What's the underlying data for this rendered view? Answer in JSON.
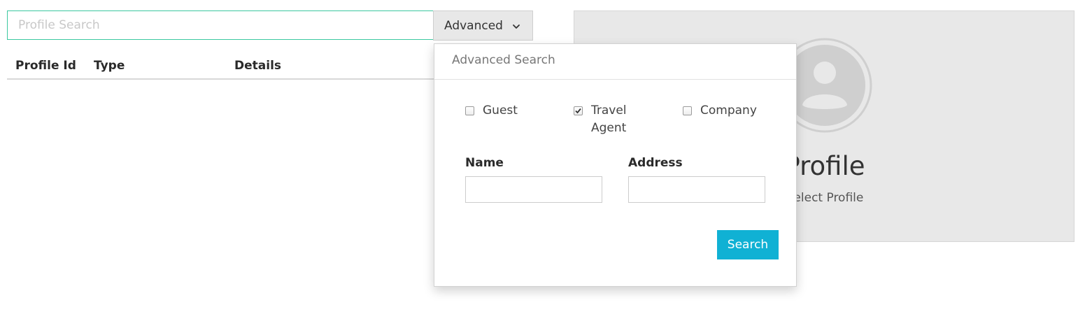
{
  "search": {
    "placeholder": "Profile Search",
    "value": ""
  },
  "advanced_button": {
    "label": "Advanced",
    "icon": "chevron-down-icon"
  },
  "table": {
    "columns": [
      "Profile Id",
      "Type",
      "Details"
    ],
    "rows": []
  },
  "profile_panel": {
    "title": "Profile",
    "subtitle": "Select Profile",
    "avatar_icon": "user-avatar-icon"
  },
  "advanced_search": {
    "title": "Advanced Search",
    "types": [
      {
        "label": "Guest",
        "checked": false
      },
      {
        "label": "Travel Agent",
        "checked": true
      },
      {
        "label": "Company",
        "checked": false
      }
    ],
    "name_label": "Name",
    "name_value": "",
    "address_label": "Address",
    "address_value": "",
    "search_label": "Search"
  },
  "colors": {
    "accent": "#10b1d4",
    "search_border": "#3cc8a0",
    "panel_bg": "#e8e8e8"
  }
}
